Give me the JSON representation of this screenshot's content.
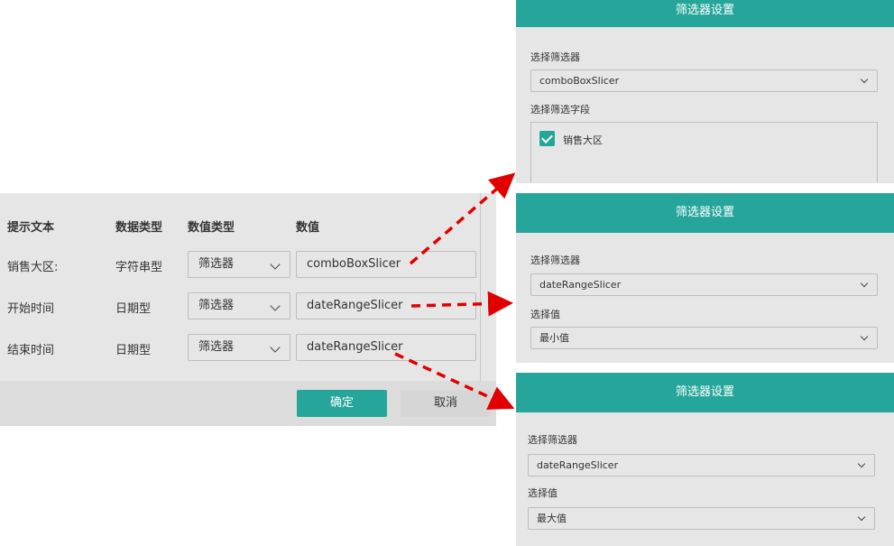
{
  "params": {
    "headers": [
      "提示文本",
      "数据类型",
      "数值类型",
      "数值"
    ],
    "rows": [
      {
        "label": "销售大区:",
        "type": "字符串型",
        "value_type": "筛选器",
        "value": "comboBoxSlicer"
      },
      {
        "label": "开始时间",
        "type": "日期型",
        "value_type": "筛选器",
        "value": "dateRangeSlicer"
      },
      {
        "label": "结束时间",
        "type": "日期型",
        "value_type": "筛选器",
        "value": "dateRangeSlicer"
      }
    ],
    "ok_label": "确定",
    "cancel_label": "取消"
  },
  "panels": [
    {
      "title": "筛选器设置",
      "slicer_label": "选择筛选器",
      "slicer_value": "comboBoxSlicer",
      "field_label": "选择筛选字段",
      "field_item": "销售大区",
      "field_checked": true
    },
    {
      "title": "筛选器设置",
      "slicer_label": "选择筛选器",
      "slicer_value": "dateRangeSlicer",
      "value_label": "选择值",
      "value_value": "最小值"
    },
    {
      "title": "筛选器设置",
      "slicer_label": "选择筛选器",
      "slicer_value": "dateRangeSlicer",
      "value_label": "选择值",
      "value_value": "最大值"
    }
  ],
  "colors": {
    "accent": "#26a69a",
    "arrow": "#e00000",
    "panel_bg": "#e6e6e6"
  }
}
